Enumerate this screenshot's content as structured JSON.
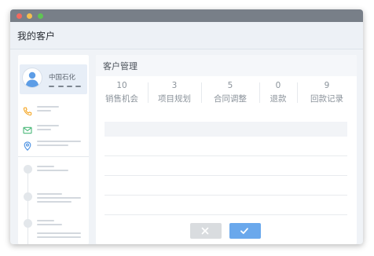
{
  "window": {
    "controls": [
      "close",
      "minimize",
      "zoom"
    ],
    "colors": {
      "titlebar": "#787f88",
      "close": "#f4695e",
      "minimize": "#f5bf4f",
      "zoom": "#5fc454"
    }
  },
  "header": {
    "title": "我的客户"
  },
  "sidebar": {
    "profile": {
      "avatar_icon": "user-avatar-icon",
      "company": "中国石化"
    },
    "contacts": [
      {
        "icon": "phone-icon",
        "color": "#f5a623"
      },
      {
        "icon": "mail-icon",
        "color": "#4cb97a"
      },
      {
        "icon": "location-pin-icon",
        "color": "#4a90e2"
      }
    ]
  },
  "main": {
    "title": "客户管理",
    "stats": [
      {
        "count": "10",
        "label": "销售机会"
      },
      {
        "count": "3",
        "label": "项目规划"
      },
      {
        "count": "5",
        "label": "合同调整"
      },
      {
        "count": "0",
        "label": "退款"
      },
      {
        "count": "9",
        "label": "回款记录"
      }
    ],
    "buttons": {
      "cancel": {
        "icon": "close-icon",
        "color": "#d9dcdf"
      },
      "confirm": {
        "icon": "checkmark-icon",
        "color": "#6aa8ec"
      }
    }
  }
}
